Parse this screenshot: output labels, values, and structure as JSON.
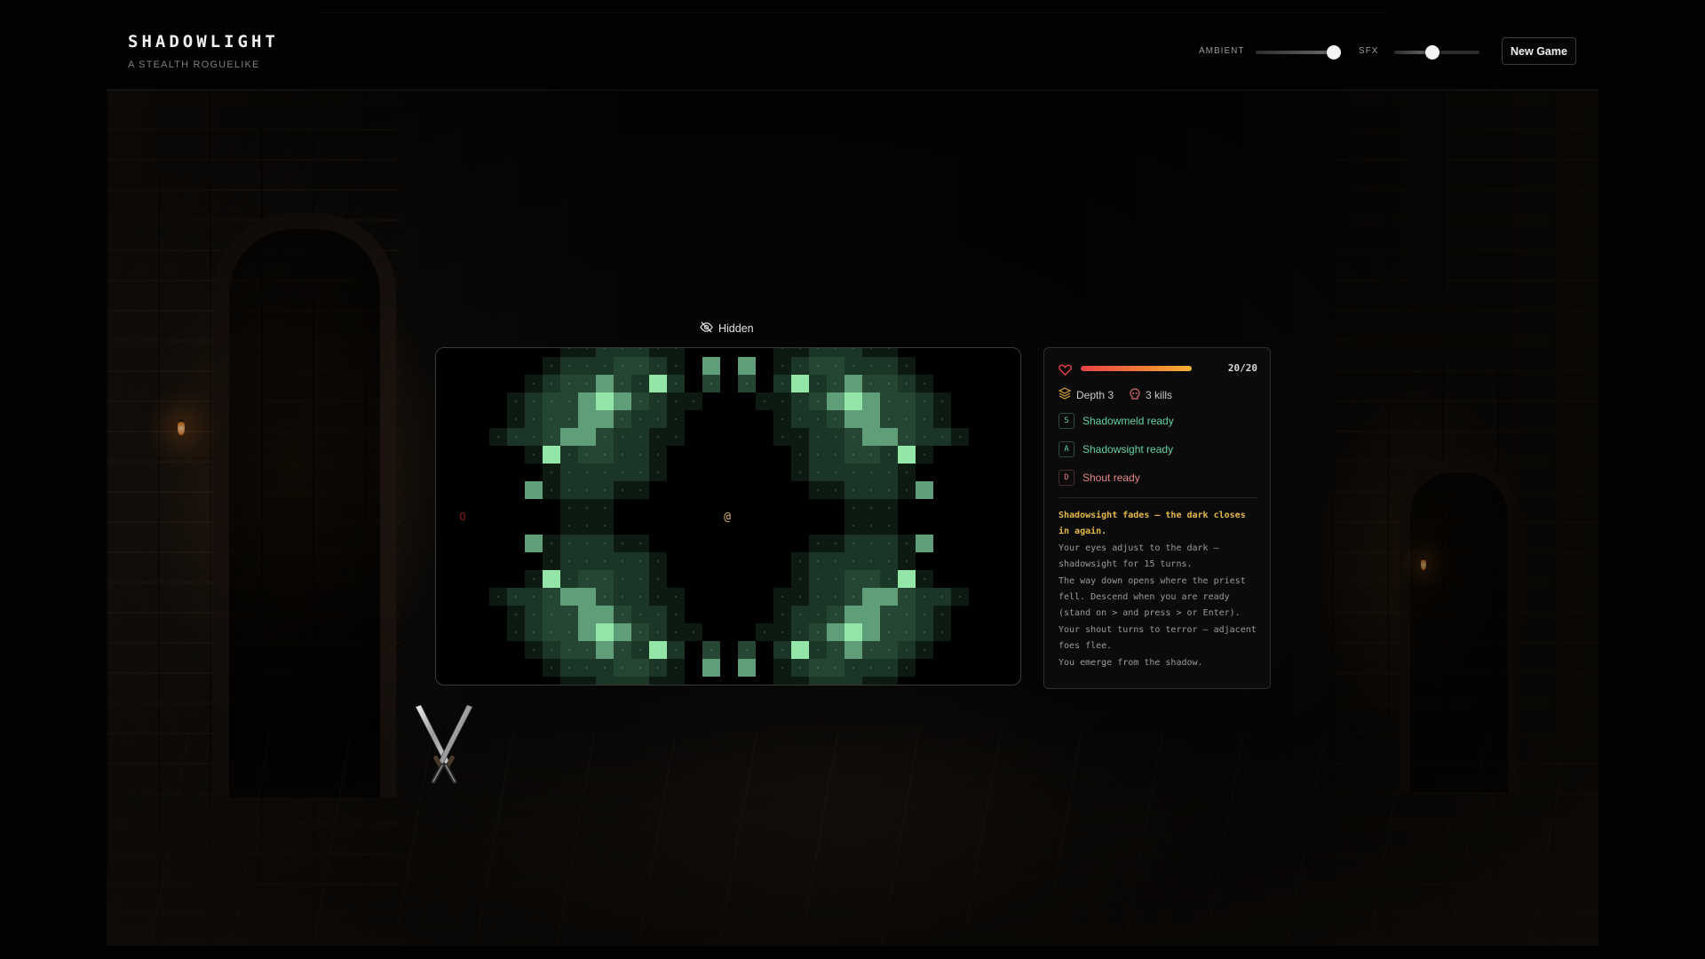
{
  "header": {
    "title": "SHADOWLIGHT",
    "subtitle": "A STEALTH ROGUELIKE",
    "ambient_label": "AMBIENT",
    "ambient_level": 0.92,
    "sfx_label": "SFX",
    "sfx_level": 0.45,
    "new_game_label": "New Game"
  },
  "status": {
    "icon": "eye-off-icon",
    "label": "Hidden"
  },
  "map": {
    "player_glyph": "@",
    "enemy_glyph": "O",
    "colors": {
      "floor_dark": "#0d1a12",
      "floor_mid": "#1b3526",
      "floor_lit": "#2f6446",
      "crystal": "#5f9e78",
      "crystal_bright": "#94e6a8",
      "player": "#d6b25e",
      "enemy": "#8a1c1c"
    }
  },
  "panel": {
    "hp_current": 20,
    "hp_max": 20,
    "hp_text": "20/20",
    "depth_label": "Depth 3",
    "kills_label": "3 kills",
    "abilities": [
      {
        "key": "S",
        "label": "Shadowmeld ready",
        "tone": "green"
      },
      {
        "key": "A",
        "label": "Shadowsight ready",
        "tone": "green"
      },
      {
        "key": "D",
        "label": "Shout ready",
        "tone": "red"
      }
    ],
    "log": [
      {
        "text": "Shadowsight fades — the dark closes in again.",
        "highlight": true
      },
      {
        "text": "Your eyes adjust to the dark — shadowsight for 15 turns.",
        "highlight": false
      },
      {
        "text": "The way down opens where the priest fell. Descend when you are ready (stand on > and press > or Enter).",
        "highlight": false
      },
      {
        "text": "Your shout turns to terror — adjacent foes flee.",
        "highlight": false
      },
      {
        "text": "You emerge from the shadow.",
        "highlight": false
      }
    ]
  }
}
